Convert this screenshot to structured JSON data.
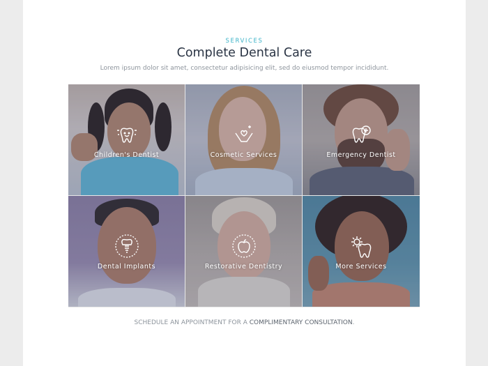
{
  "section": {
    "eyebrow": "SERVICES",
    "title": "Complete Dental Care",
    "subtitle": "Lorem ipsum dolor sit amet, consectetur adipisicing elit, sed do eiusmod tempor incididunt."
  },
  "services": [
    {
      "label": "Children's Dentist",
      "icon": "child-tooth-icon"
    },
    {
      "label": "Cosmetic Services",
      "icon": "sparkle-hands-icon"
    },
    {
      "label": "Emergency Dentist",
      "icon": "tooth-plus-icon"
    },
    {
      "label": "Dental Implants",
      "icon": "implant-icon"
    },
    {
      "label": "Restorative Dentistry",
      "icon": "apple-icon"
    },
    {
      "label": "More Services",
      "icon": "gear-tooth-icon"
    }
  ],
  "cta": {
    "prefix": "SCHEDULE AN APPOINTMENT FOR A",
    "link": "COMPLIMENTARY CONSULTATION",
    "suffix": "."
  },
  "colors": {
    "accent": "#3bb3c8",
    "heading": "#2a3444",
    "muted": "#8d949c",
    "page_bg": "#ececec"
  }
}
